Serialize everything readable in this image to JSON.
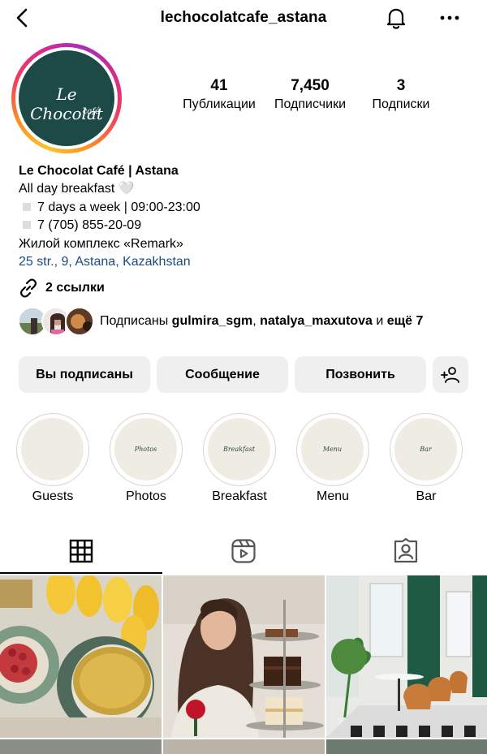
{
  "header": {
    "username": "lechocolatcafe_astana"
  },
  "icons": {
    "back": "chevron-left-icon",
    "bell": "bell-icon",
    "more": "more-horizontal-icon",
    "link": "link-icon",
    "add_person": "add-person-icon",
    "grid": "grid-icon",
    "reels": "reels-icon",
    "tagged": "tagged-icon"
  },
  "profile": {
    "logo_text": "Le Chocolat",
    "logo_sub": "café",
    "stats": [
      {
        "value": "41",
        "label": "Публикации"
      },
      {
        "value": "7,450",
        "label": "Подписчики"
      },
      {
        "value": "3",
        "label": "Подписки"
      }
    ]
  },
  "bio": {
    "name": "Le Chocolat Café | Astana",
    "tagline": "All day breakfast",
    "tagline_emoji": "🤍",
    "hours": "7 days a week | 09:00-23:00",
    "phone": "7 (705) 855-20-09",
    "complex": "Жилой комплекс «Remark»",
    "address": "25 str., 9, Astana, Kazakhstan"
  },
  "links": {
    "label": "2 ссылки"
  },
  "followed_by": {
    "prefix": "Подписаны",
    "user1": "gulmira_sgm",
    "separator": ",",
    "user2": "natalya_maxutova",
    "and": "и",
    "more": "ещё 7"
  },
  "actions": {
    "following": "Вы подписаны",
    "message": "Сообщение",
    "call": "Позвонить"
  },
  "highlights": [
    {
      "label": "Guests",
      "cover_text": ""
    },
    {
      "label": "Photos",
      "cover_text": "Photos"
    },
    {
      "label": "Breakfast",
      "cover_text": "Breakfast"
    },
    {
      "label": "Menu",
      "cover_text": "Menu"
    },
    {
      "label": "Bar",
      "cover_text": "Bar"
    }
  ],
  "colors": {
    "brand_green": "#1d4a47",
    "link_blue": "#1b4b82",
    "button_bg": "#efefef"
  }
}
